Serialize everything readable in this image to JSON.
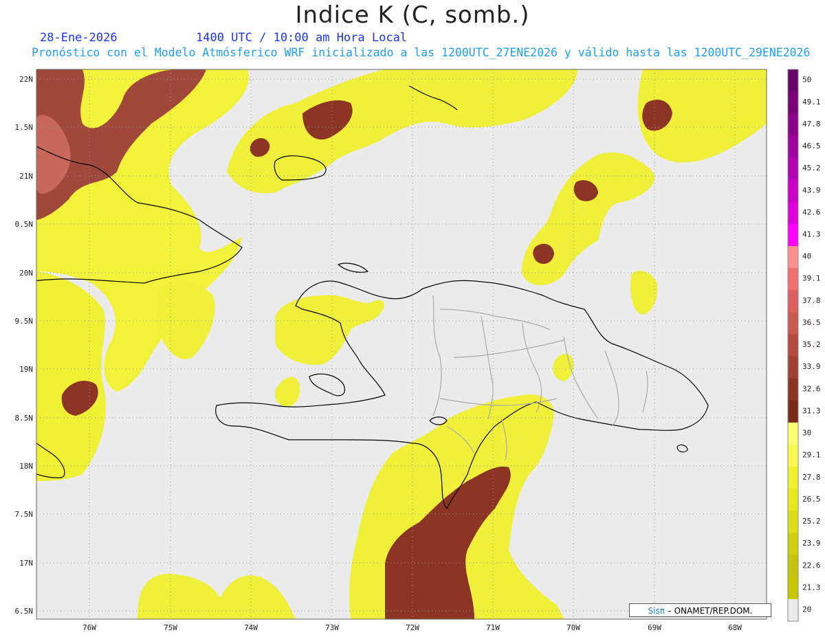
{
  "header": {
    "title": "Indice K (C, somb.)",
    "date": "28-Ene-2026",
    "time": "1400 UTC / 10:00 am Hora Local",
    "subtitle": "Pronóstico con el Modelo Atmósferico WRF inicializado a las 1200UTC_27ENE2026 y válido hasta las  1200UTC_29ENE2026"
  },
  "map": {
    "lat_labels": [
      "22N",
      "1.5N",
      "21N",
      "0.5N",
      "20N",
      "9.5N",
      "19N",
      "8.5N",
      "18N",
      "7.5N",
      "17N",
      "6.5N"
    ],
    "lon_labels": [
      "76W",
      "75W",
      "74W",
      "73W",
      "72W",
      "71W",
      "70W",
      "69W",
      "68W"
    ],
    "background_color": "#ebebeb",
    "coast_color": "#000000",
    "province_color": "#aaaaaa"
  },
  "colorbar": {
    "labels": [
      "50",
      "49.1",
      "47.8",
      "46.5",
      "45.2",
      "43.9",
      "42.6",
      "41.3",
      "40",
      "39.1",
      "37.8",
      "36.5",
      "35.2",
      "33.9",
      "32.6",
      "31.3",
      "30",
      "29.1",
      "27.8",
      "26.5",
      "25.2",
      "23.9",
      "22.6",
      "21.3",
      "20"
    ],
    "colors": [
      "#6a006a",
      "#7a007a",
      "#8c008c",
      "#a000a0",
      "#b400b4",
      "#c800c8",
      "#dc00dc",
      "#ff00ff",
      "#ff9090",
      "#f07070",
      "#dc6060",
      "#c85a50",
      "#b44a40",
      "#a03f33",
      "#8c3525",
      "#7a2b18",
      "#ffff70",
      "#f8f850",
      "#f0f030",
      "#e8e820",
      "#dcdc18",
      "#cfcf10",
      "#c4c40a",
      "#c8c800",
      "#ececec"
    ]
  },
  "credit": {
    "logo": "Sisπ",
    "text": "– ONAMET/REP.DOM."
  }
}
